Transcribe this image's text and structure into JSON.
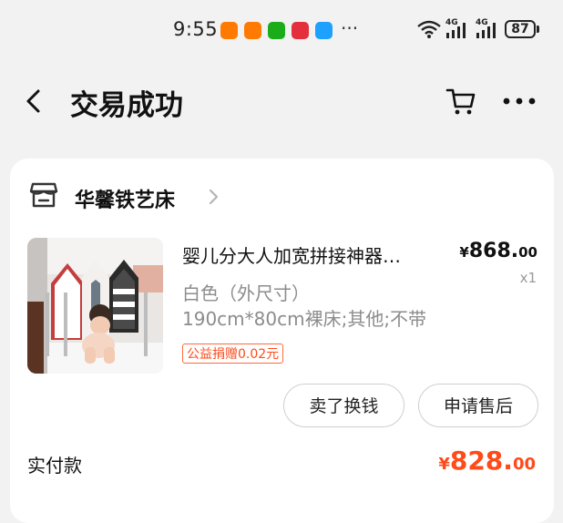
{
  "status_bar": {
    "time": "9:55",
    "overflow": "···",
    "network_1": "4G",
    "network_2": "4G",
    "battery": "87",
    "app_icons": [
      "taobao-icon",
      "taobao-icon",
      "wechat-icon",
      "xiaohongshu-icon",
      "message-icon"
    ]
  },
  "nav": {
    "title": "交易成功",
    "back_icon": "chevron-left-icon",
    "cart_icon": "cart-icon",
    "more_icon": "more-icon"
  },
  "order": {
    "shop_name": "华馨铁艺床",
    "product_title": "婴儿分大人加宽拼接神器…",
    "price_symbol": "¥",
    "price_int": "868.",
    "price_dec": "00",
    "quantity": "x1",
    "sku_line1": "白色（外尺寸）",
    "sku_line2": "190cm*80cm裸床;其他;不带",
    "charity_badge": "公益捐赠0.02元",
    "actions": [
      "卖了换钱",
      "申请售后"
    ],
    "paid_label": "实付款",
    "paid_symbol": "¥",
    "paid_int": "828.",
    "paid_dec": "00"
  },
  "colors": {
    "accent": "#ff4a1a",
    "background": "#f2f2f2",
    "card": "#ffffff"
  }
}
